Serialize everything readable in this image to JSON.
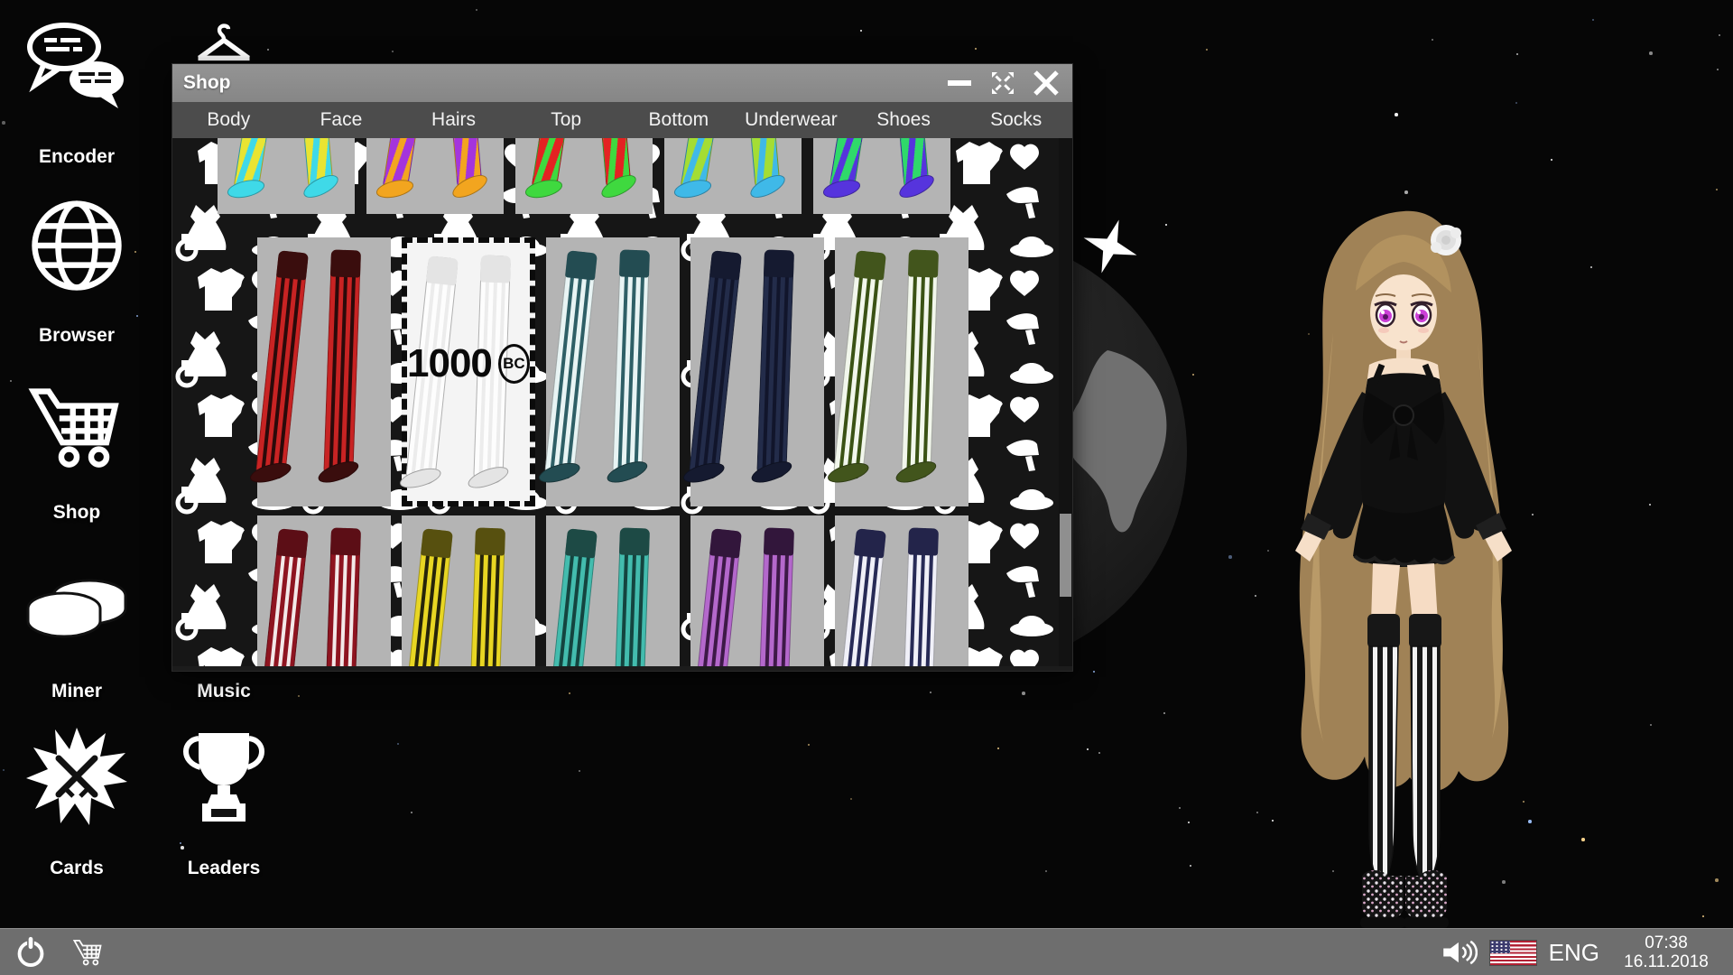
{
  "desktop": {
    "icons_left": [
      {
        "id": "encoder",
        "label": "Encoder",
        "icon": "speech-bubbles-icon"
      },
      {
        "id": "browser",
        "label": "Browser",
        "icon": "globe-icon"
      },
      {
        "id": "shop",
        "label": "Shop",
        "icon": "shopping-cart-icon"
      },
      {
        "id": "miner",
        "label": "Miner",
        "icon": "coins-icon"
      },
      {
        "id": "cards",
        "label": "Cards",
        "icon": "battle-burst-icon"
      }
    ],
    "icons_right": [
      {
        "id": "wardrobe",
        "label": "",
        "icon": "hanger-icon"
      },
      {
        "id": "music",
        "label": "Music",
        "icon": "music-icon"
      },
      {
        "id": "leaders",
        "label": "Leaders",
        "icon": "trophy-icon"
      }
    ]
  },
  "shop_window": {
    "title": "Shop",
    "controls": {
      "minimize": "minimize",
      "maximize": "maximize",
      "close": "close"
    },
    "tabs": [
      "Body",
      "Face",
      "Hairs",
      "Top",
      "Bottom",
      "Underwear",
      "Shoes",
      "Socks"
    ],
    "active_tab": "Socks",
    "selected_item": {
      "price": "1000",
      "currency": "BC",
      "name": "white-stockings"
    },
    "rows": [
      {
        "style": "ankle",
        "items": [
          {
            "name": "yellow-cyan-striped-socks",
            "base": "#e9e432",
            "stripe": "#3fd9e8"
          },
          {
            "name": "purple-orange-striped-socks",
            "base": "#a434dd",
            "stripe": "#f2a51f"
          },
          {
            "name": "red-green-striped-socks",
            "base": "#e42222",
            "stripe": "#3fd93f"
          },
          {
            "name": "lime-cyan-striped-socks",
            "base": "#a4dd34",
            "stripe": "#3fb9e8"
          },
          {
            "name": "green-violet-striped-socks",
            "base": "#2fd96a",
            "stripe": "#5634dd"
          }
        ]
      },
      {
        "style": "stocking",
        "items": [
          {
            "name": "red-black-striped-stockings",
            "base": "#c82323",
            "stripe": "#2a0a0a",
            "cuff": "#3a0d0d"
          },
          {
            "name": "white-stockings",
            "base": "#fdfdfd",
            "stripe": "#ececec",
            "cuff": "#e4e4e4",
            "selected": true
          },
          {
            "name": "teal-white-striped-stockings",
            "base": "#e8f4f4",
            "stripe": "#2e5f66",
            "cuff": "#234c52"
          },
          {
            "name": "navy-striped-stockings",
            "base": "#232c4a",
            "stripe": "#11152b",
            "cuff": "#151a30"
          },
          {
            "name": "green-white-striped-stockings",
            "base": "#f2f7ec",
            "stripe": "#3a5214",
            "cuff": "#42551c"
          }
        ]
      },
      {
        "style": "stocking",
        "items": [
          {
            "name": "darkred-white-striped-stockings",
            "base": "#8e1420",
            "stripe": "#f3e9e9",
            "cuff": "#5c0e16"
          },
          {
            "name": "yellow-black-striped-stockings",
            "base": "#e8d623",
            "stripe": "#26240a",
            "cuff": "#57500f"
          },
          {
            "name": "teal-striped-stockings",
            "base": "#43bcae",
            "stripe": "#14443f",
            "cuff": "#1d4a45"
          },
          {
            "name": "violet-striped-stockings",
            "base": "#b468cc",
            "stripe": "#3d1947",
            "cuff": "#32163b"
          },
          {
            "name": "navy-white-striped-stockings",
            "base": "#f0f0f8",
            "stripe": "#272a56",
            "cuff": "#23244a"
          }
        ]
      }
    ]
  },
  "taskbar": {
    "language": "ENG",
    "time": "07:38",
    "date": "16.11.2018",
    "icons": [
      "power-icon",
      "cart-icon",
      "speaker-icon",
      "us-flag-icon"
    ]
  },
  "colors": {
    "titlebar": "#8d8d8d",
    "tabsbar": "#4c4c4c",
    "tile": "#b4b4b4",
    "selected_tile": "#f4f4f4",
    "taskbar": "#6e6e6e",
    "planet": "#212121",
    "continent": "#707070",
    "background": "#060606"
  }
}
